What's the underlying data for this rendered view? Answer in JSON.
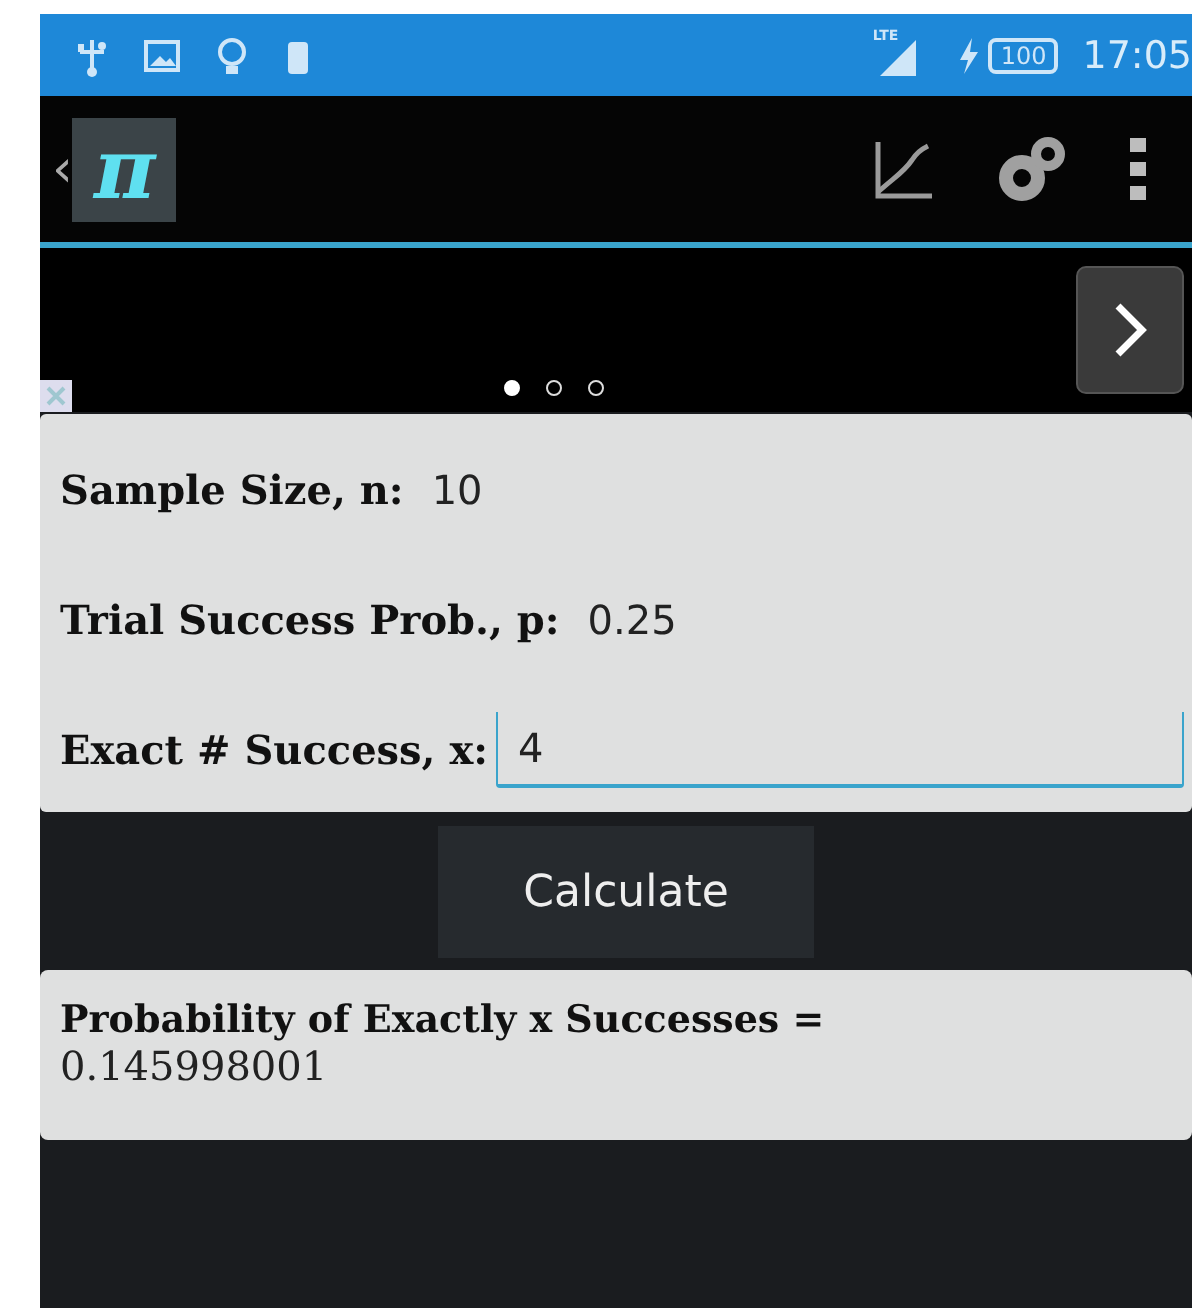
{
  "status_bar": {
    "network": "LTE",
    "battery": "100",
    "time": "17:05"
  },
  "action_bar": {
    "logo": "π",
    "back": "‹"
  },
  "ad_banner": {
    "pages": [
      {
        "selected": true
      },
      {
        "selected": false
      },
      {
        "selected": false
      }
    ]
  },
  "fields": [
    {
      "label": "Sample Size, n:",
      "value": "10",
      "focused": false
    },
    {
      "label": "Trial Success Prob., p:",
      "value": "0.25",
      "focused": false
    },
    {
      "label": "Exact # Success, x:",
      "value": "4",
      "focused": true
    }
  ],
  "calculate_button": "Calculate",
  "result": {
    "label": "Probability of Exactly x Successes =",
    "value": "0.145998001"
  }
}
